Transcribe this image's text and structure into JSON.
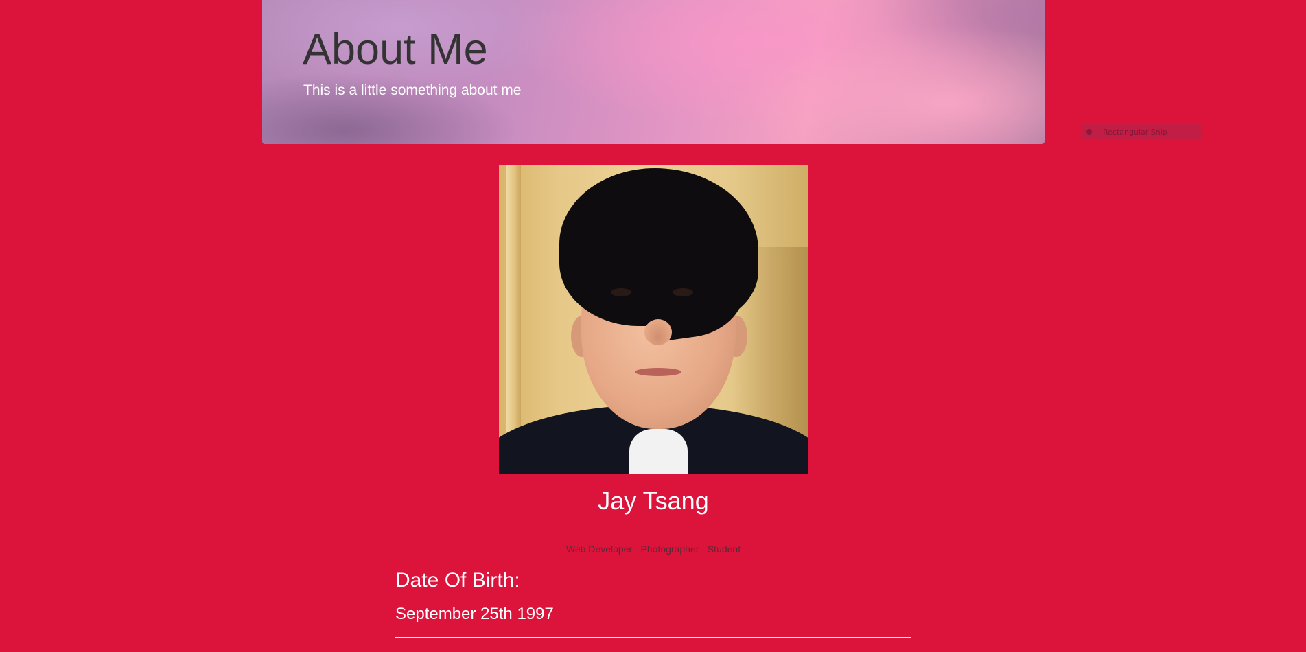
{
  "header": {
    "title": "About Me",
    "subtitle": "This is a little something about me"
  },
  "snip_tool": {
    "label": "Rectangular Snip",
    "icon": "snip-icon"
  },
  "profile": {
    "photo": "profile-photo",
    "name": "Jay Tsang",
    "roles": "Web Developer - Photographer - Student"
  },
  "details": {
    "dob_label": "Date Of Birth:",
    "dob_value": "September 25th 1997"
  },
  "colors": {
    "background": "#dc143c",
    "title_text": "#333333",
    "body_text": "#ffffff"
  }
}
